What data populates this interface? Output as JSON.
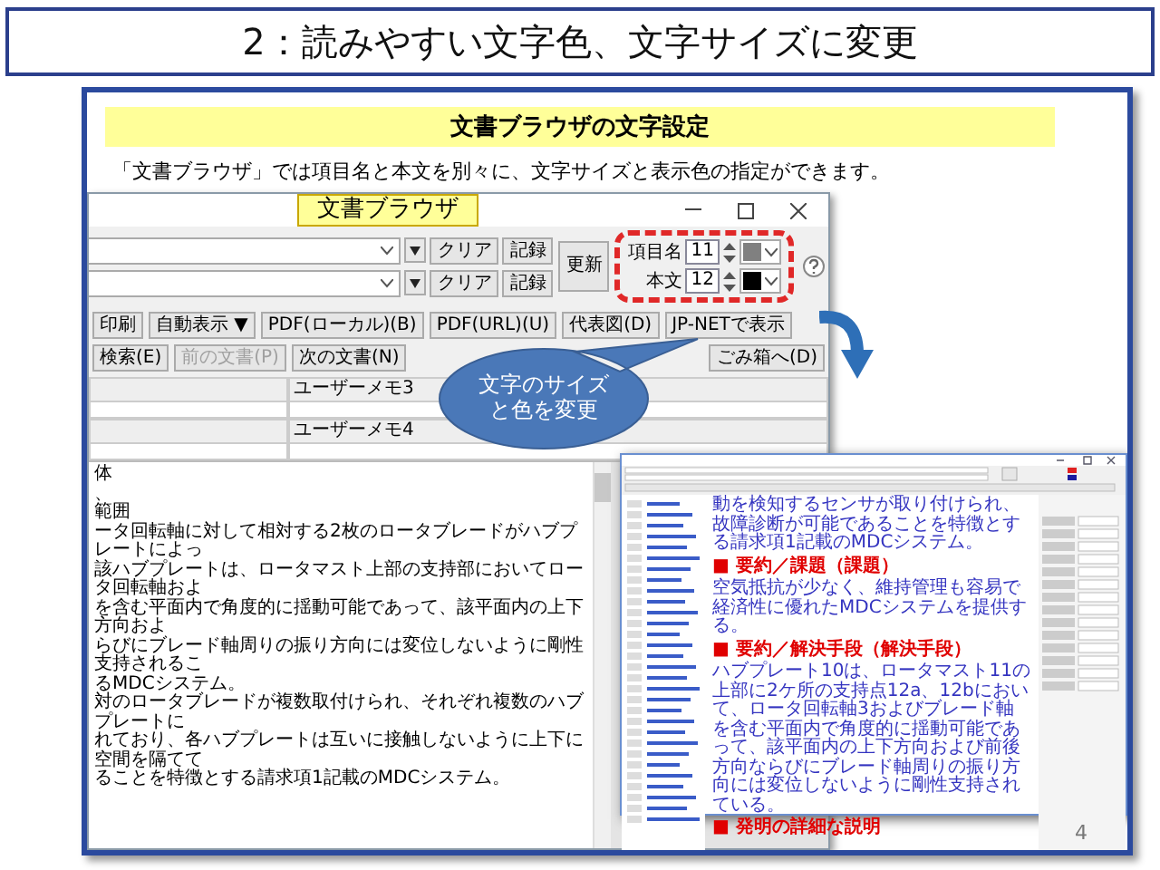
{
  "slide_title": "2：読みやすい文字色、文字サイズに変更",
  "banner": "文書ブラウザの文字設定",
  "description": "「文書ブラウザ」では項目名と本文を別々に、文字サイズと表示色の指定ができます。",
  "browser_window": {
    "title": "文書ブラウザ",
    "search_rows": [
      {
        "buttons": [
          "クリア",
          "記録"
        ]
      },
      {
        "buttons": [
          "クリア",
          "記録"
        ]
      }
    ],
    "update_button": "更新",
    "font_settings": [
      {
        "label": "項目名",
        "size": "11",
        "color": "#808080"
      },
      {
        "label": "本文",
        "size": "12",
        "color": "#000000"
      }
    ],
    "toolbar": [
      {
        "label": "印刷",
        "disabled": false
      },
      {
        "label": "自動表示 ▼",
        "disabled": false
      },
      {
        "label": "PDF(ローカル)(B)",
        "disabled": false
      },
      {
        "label": "PDF(URL)(U)",
        "disabled": false
      },
      {
        "label": "代表図(D)",
        "disabled": false
      },
      {
        "label": "JP-NETで表示",
        "disabled": false
      },
      {
        "label": "検索(E)",
        "disabled": false
      },
      {
        "label": "前の文書(P)",
        "disabled": true
      },
      {
        "label": "次の文書(N)",
        "disabled": false
      }
    ],
    "trash_button": "ごみ箱へ(D)",
    "memos": [
      "ユーザーメモ3",
      "ユーザーメモ4"
    ],
    "document_text": [
      "体",
      "、",
      "範囲",
      "ータ回転軸に対して相対する2枚のロータブレードがハブプレートによっ",
      "該ハブプレートは、ロータマスト上部の支持部においてロータ回転軸およ",
      "を含む平面内で角度的に揺動可能であって、該平面内の上下方向およ",
      "らびにブレード軸周りの振り方向には変位しないように剛性支持されるこ",
      "るMDCシステム。",
      "対のロータブレードが複数取付けられ、それぞれ複数のハブプレートに",
      "れており、各ハブプレートは互いに接触しないように上下に空間を隔てて",
      "ることを特徴とする請求項1記載のMDCシステム。"
    ]
  },
  "callout": [
    "文字のサイズ",
    "と色を変更"
  ],
  "preview_window": {
    "sections": [
      {
        "kind": "text",
        "text": "動を検知するセンサが取り付けられ、故障診断が可能であることを特徴とする請求項1記載のMDCシステム。"
      },
      {
        "kind": "heading",
        "text": "■ 要約／課題（課題）"
      },
      {
        "kind": "text",
        "text": "空気抵抗が少なく、維持管理も容易で経済性に優れたMDCシステムを提供する。"
      },
      {
        "kind": "heading",
        "text": "■ 要約／解決手段（解決手段）"
      },
      {
        "kind": "text",
        "text": "ハブプレート10は、ロータマスト11の上部に2ケ所の支持点12a、12bにおいて、ロータ回転軸3およびブレード軸を含む平面内で角度的に揺動可能であって、該平面内の上下方向および前後方向ならびにブレード軸周りの振り方向には変位しないように剛性支持されている。"
      },
      {
        "kind": "heading",
        "text": "■ 発明の詳細な説明"
      }
    ]
  },
  "page_number": "4"
}
